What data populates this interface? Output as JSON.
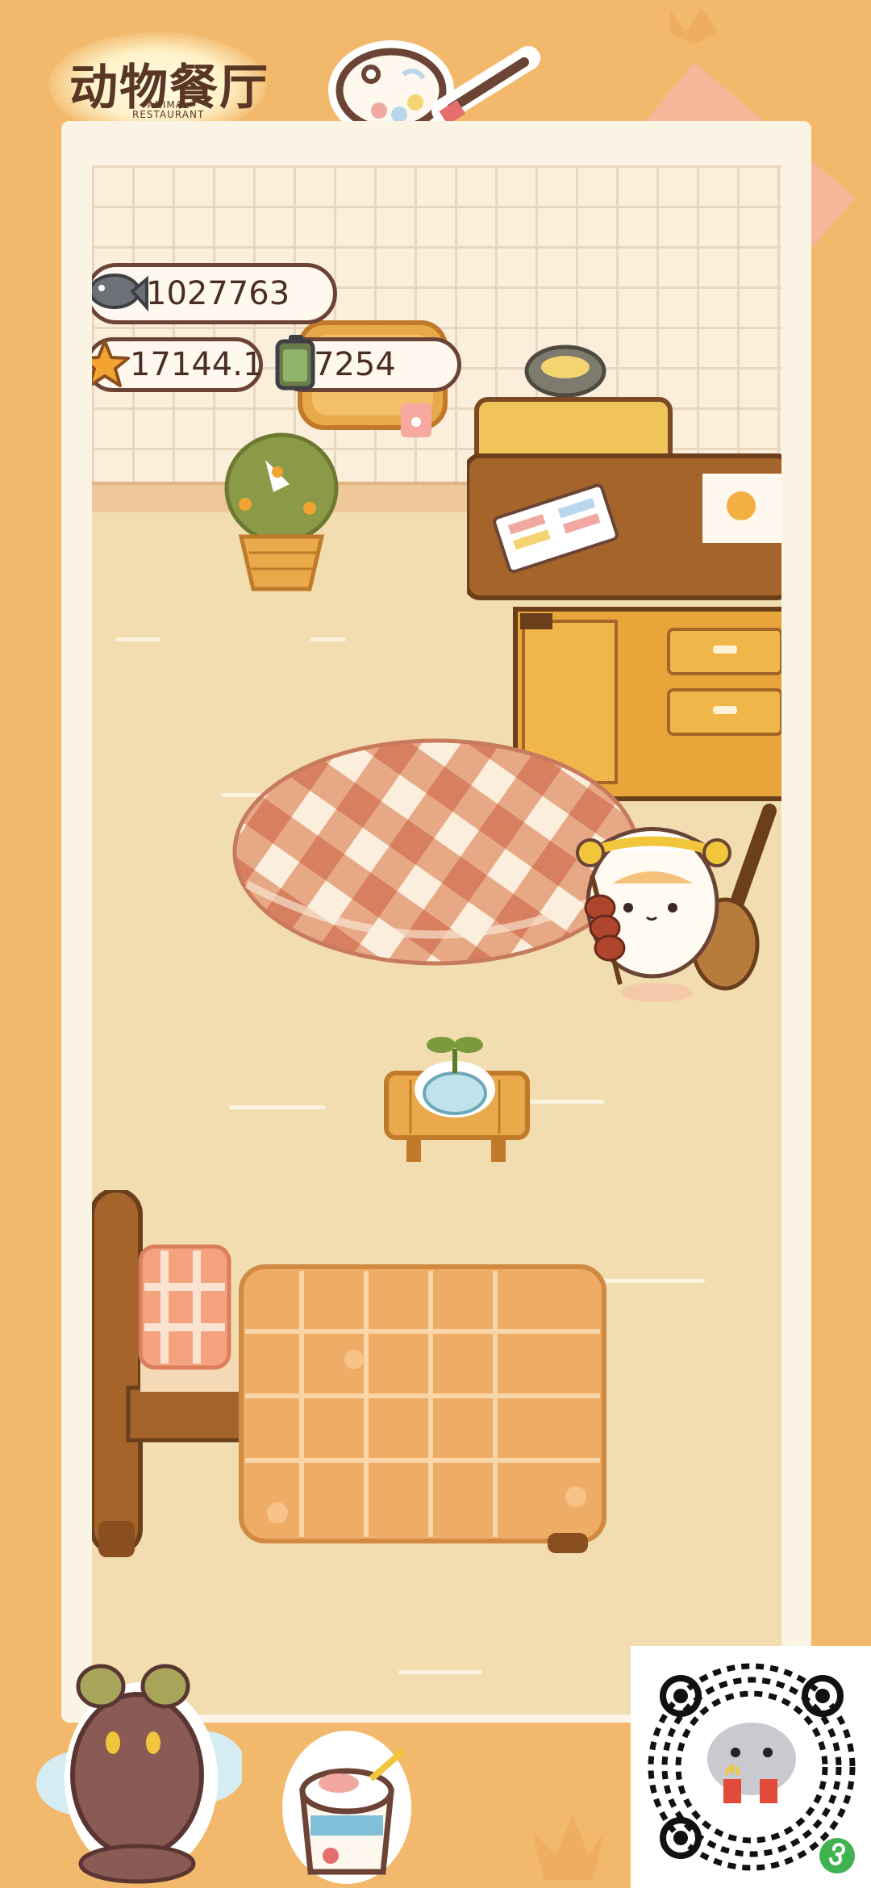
{
  "app": {
    "logo_title": "动物餐厅",
    "logo_subtitle_1": "ANIMAL",
    "logo_subtitle_2": "RESTAURANT"
  },
  "resources": {
    "fish_count": "1027763",
    "star_count": "17144.1",
    "battery_count": "7254"
  },
  "icons": {
    "fish": "fish-icon",
    "star": "star-icon",
    "battery": "battery-icon",
    "qr": "qr-code",
    "mini_program": "mini-program-icon"
  },
  "colors": {
    "background": "#f2b96c",
    "frame": "#fbf3e3",
    "floor": "#f1ddb0",
    "outline": "#6b4436",
    "accent_green": "#3fb34f"
  }
}
